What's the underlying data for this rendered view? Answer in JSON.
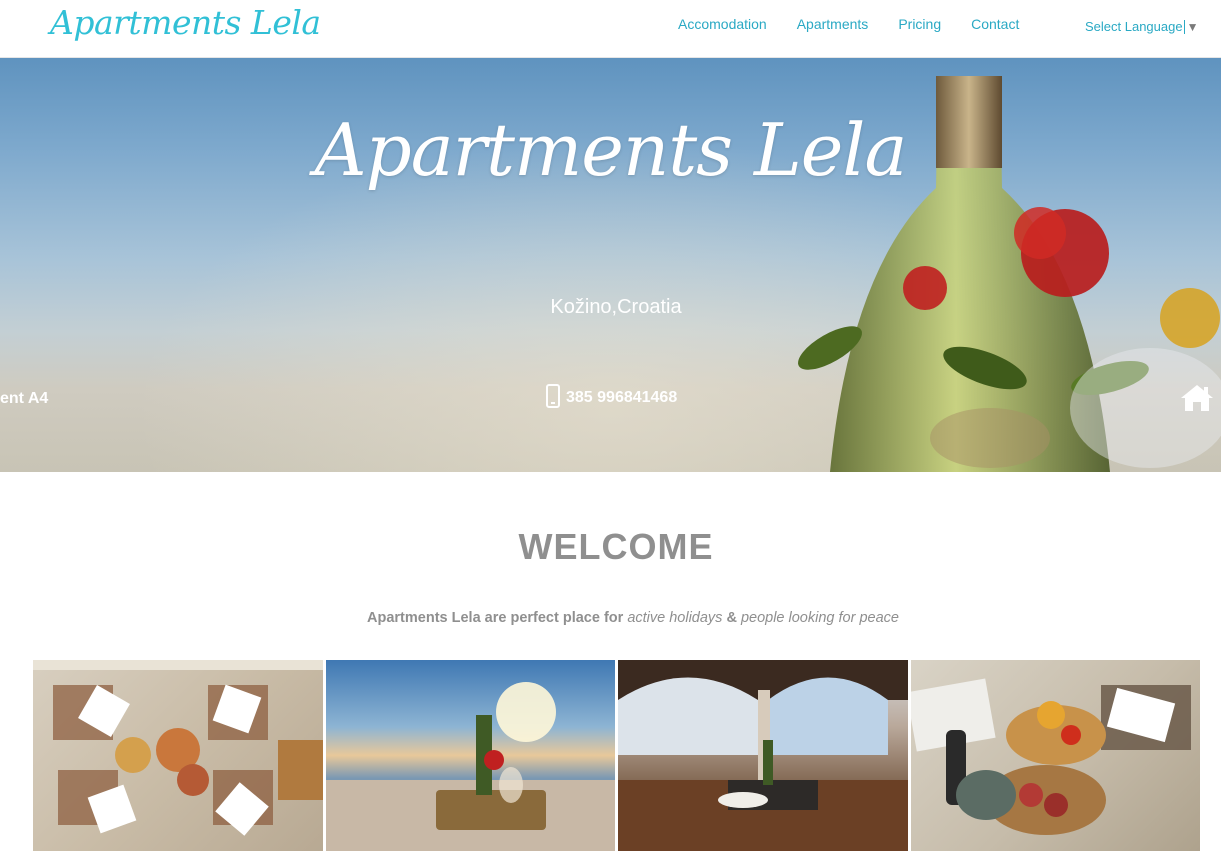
{
  "header": {
    "logo": "Apartments Lela",
    "nav": [
      {
        "label": "Accomodation"
      },
      {
        "label": "Apartments"
      },
      {
        "label": "Pricing"
      },
      {
        "label": "Contact"
      }
    ],
    "language_select": "Select Language",
    "language_caret": "▼"
  },
  "hero": {
    "title": "Apartments Lela",
    "location": "Kožino,Croatia",
    "ticker_left": "ent A4",
    "phone": "385 996841468",
    "ticker_right_icon": "home-icon"
  },
  "welcome": {
    "heading": "WELCOME",
    "tagline_prefix": "Apartments Lela are perfect place for ",
    "tagline_em1": "active holidays",
    "tagline_mid": " & ",
    "tagline_em2": "people looking for peace"
  },
  "gallery": [
    {
      "name": "gallery-photo-table-spread"
    },
    {
      "name": "gallery-photo-sea-sunset"
    },
    {
      "name": "gallery-photo-terrace-dining"
    },
    {
      "name": "gallery-photo-prosciutto-board"
    }
  ],
  "colors": {
    "accent": "#2aa9c4",
    "heading_gray": "#8f8f8f"
  }
}
